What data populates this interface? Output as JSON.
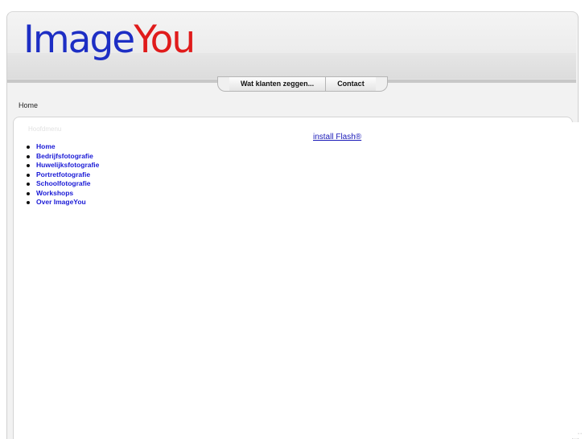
{
  "logo": {
    "part1": "Image",
    "part2": "You"
  },
  "nav": {
    "items": [
      {
        "label": "Wat klanten zeggen..."
      },
      {
        "label": "Contact"
      }
    ]
  },
  "breadcrumb": "Home",
  "menu": {
    "title": "Hoofdmenu",
    "items": [
      {
        "label": "Home"
      },
      {
        "label": "Bedrijfsfotografie"
      },
      {
        "label": "Huwelijksfotografie"
      },
      {
        "label": "Portretfotografie"
      },
      {
        "label": "Schoolfotografie"
      },
      {
        "label": "Workshops"
      },
      {
        "label": "Over ImageYou"
      }
    ]
  },
  "flash_link": "install Flash®",
  "corner_mark": "• •",
  "colors": {
    "logo_blue": "#1d2ec4",
    "logo_red": "#e01b1b",
    "link": "#1a1ad6"
  }
}
